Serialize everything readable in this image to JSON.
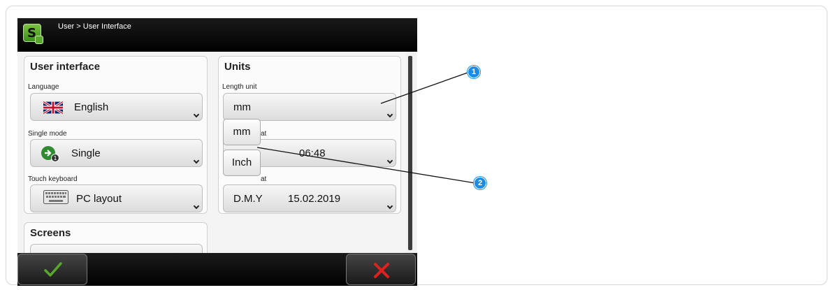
{
  "titlebar": {
    "breadcrumb": "User > User Interface",
    "app_icon_letter": "S"
  },
  "user_interface": {
    "title": "User interface",
    "language": {
      "label": "Language",
      "value": "English",
      "icon": "uk-flag-icon"
    },
    "single_mode": {
      "label": "Single mode",
      "value": "Single",
      "icon": "single-mode-icon"
    },
    "touch_keyboard": {
      "label": "Touch keyboard",
      "value": "PC layout",
      "icon": "keyboard-icon"
    }
  },
  "units": {
    "title": "Units",
    "length_unit": {
      "label": "Length unit",
      "value": "mm"
    },
    "time_format": {
      "label_partial": "at",
      "value": "06:48"
    },
    "date_format": {
      "label_partial": "at",
      "format": "D.M.Y",
      "value": "15.02.2019"
    }
  },
  "popup": {
    "options": [
      "mm",
      "Inch"
    ]
  },
  "screens": {
    "title": "Screens"
  },
  "bottombar": {
    "ok_icon": "checkmark-icon",
    "cancel_icon": "close-icon"
  },
  "callouts": [
    "1",
    "2"
  ],
  "colors": {
    "accent_green": "#5aa82b",
    "cancel_red": "#e02020",
    "callout_blue": "#1e8be0"
  }
}
